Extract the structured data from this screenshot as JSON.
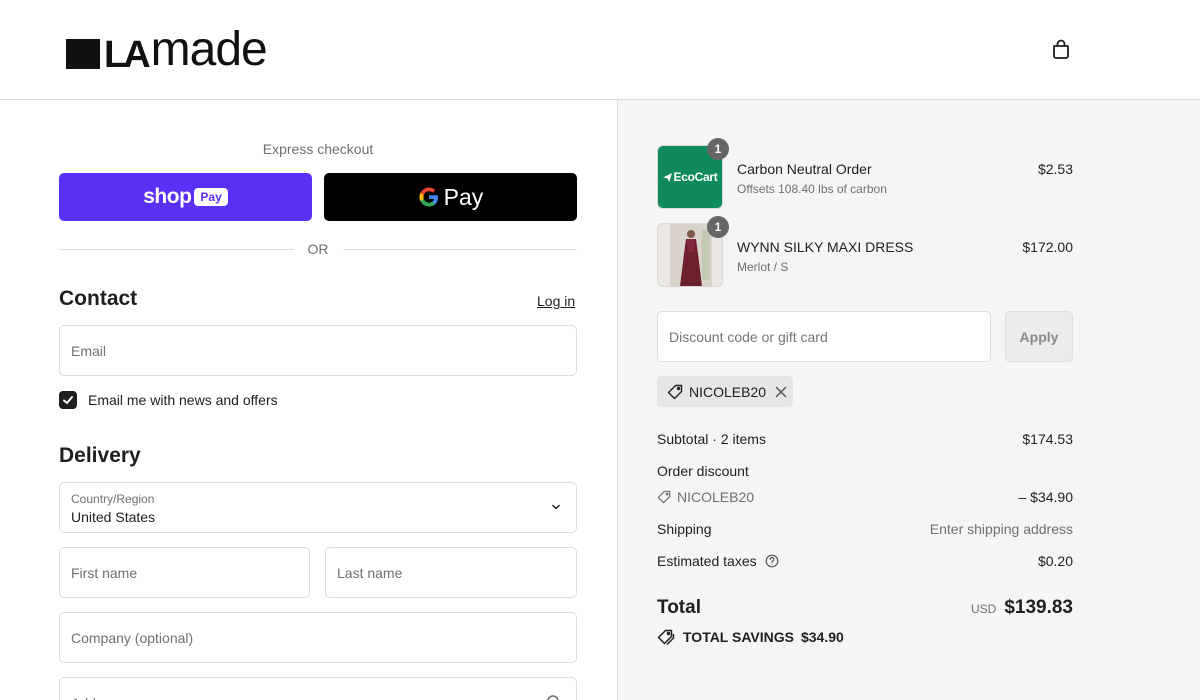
{
  "header": {
    "logo_text": "LAmade",
    "bag_icon": "shopping-bag-icon"
  },
  "express": {
    "label": "Express checkout",
    "shop_pay": {
      "shop": "shop",
      "pay": "Pay"
    },
    "google_pay": {
      "g": "G",
      "pay": "Pay"
    },
    "or": "OR"
  },
  "contact": {
    "title": "Contact",
    "login": "Log in",
    "email_placeholder": "Email",
    "newsletter_label": "Email me with news and offers",
    "newsletter_checked": true
  },
  "delivery": {
    "title": "Delivery",
    "country_label": "Country/Region",
    "country_value": "United States",
    "first_name_placeholder": "First name",
    "last_name_placeholder": "Last name",
    "company_placeholder": "Company (optional)",
    "address_placeholder": "Address"
  },
  "summary": {
    "items": [
      {
        "name": "Carbon Neutral Order",
        "sub": "Offsets 108.40 lbs of carbon",
        "price": "$2.53",
        "qty": "1",
        "thumb_label": "EcoCart"
      },
      {
        "name": "WYNN SILKY MAXI DRESS",
        "sub": "Merlot / S",
        "price": "$172.00",
        "qty": "1"
      }
    ],
    "discount_placeholder": "Discount code or gift card",
    "apply": "Apply",
    "applied_code": "NICOLEB20",
    "subtotal_label": "Subtotal · 2 items",
    "subtotal_value": "$174.53",
    "order_discount_label": "Order discount",
    "order_discount_code": "NICOLEB20",
    "order_discount_value": "– $34.90",
    "shipping_label": "Shipping",
    "shipping_value": "Enter shipping address",
    "taxes_label": "Estimated taxes",
    "taxes_value": "$0.20",
    "total_label": "Total",
    "total_currency": "USD",
    "total_value": "$139.83",
    "savings_label": "TOTAL SAVINGS",
    "savings_value": "$34.90"
  },
  "colors": {
    "shop_pay": "#5a31f4",
    "ecocart": "#0f8a5c",
    "summary_bg": "#f5f5f5"
  }
}
